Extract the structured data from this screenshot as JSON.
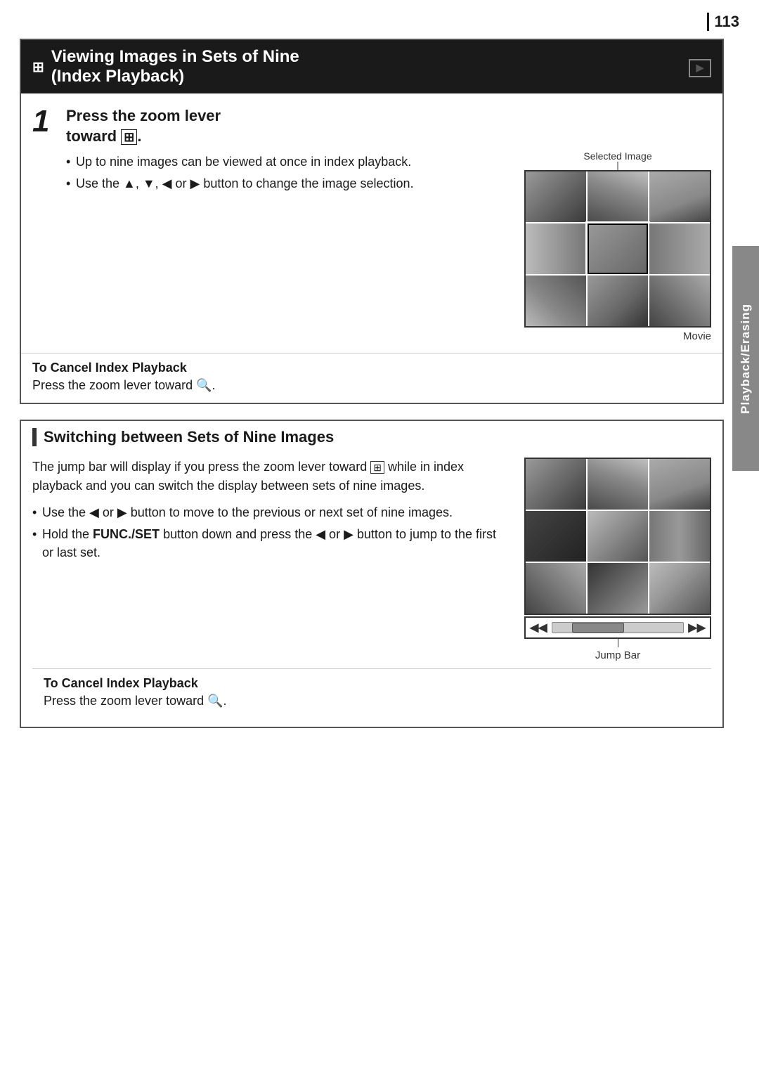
{
  "page": {
    "number": "113",
    "side_tab": "Playback/Erasing"
  },
  "section1": {
    "header": "Viewing Images in Sets of Nine\n(Index Playback)",
    "header_icon": "⊞",
    "playback_icon": "▶",
    "step_number": "1",
    "step_title_line1": "Press the zoom lever",
    "step_title_line2": "toward",
    "step_title_icon": "⊞",
    "bullet1": "Up to nine images can be viewed at once in index playback.",
    "bullet2_pre": "Use the ▲, ▼, ◀ or ▶ button to change the image selection.",
    "selected_image_label": "Selected Image",
    "movie_label": "Movie",
    "cancel_title": "To Cancel Index Playback",
    "cancel_text_pre": "Press the zoom lever toward",
    "cancel_icon": "🔍"
  },
  "section2": {
    "header": "Switching between Sets of Nine Images",
    "intro": "The jump bar will display if you press the zoom lever toward ⊞ while in index playback and you can switch the display between sets of nine images.",
    "bullet1_pre": "Use the ◀ or ▶ button to move to the previous or next set of nine images.",
    "bullet2_pre1": "Hold the ",
    "bullet2_bold": "FUNC./SET",
    "bullet2_pre2": " button down and press the ◀ or ▶ button to jump to the first or last set.",
    "jump_bar_label": "Jump Bar",
    "cancel_title": "To Cancel Index Playback",
    "cancel_text_pre": "Press the zoom lever toward",
    "cancel_icon": "🔍"
  }
}
